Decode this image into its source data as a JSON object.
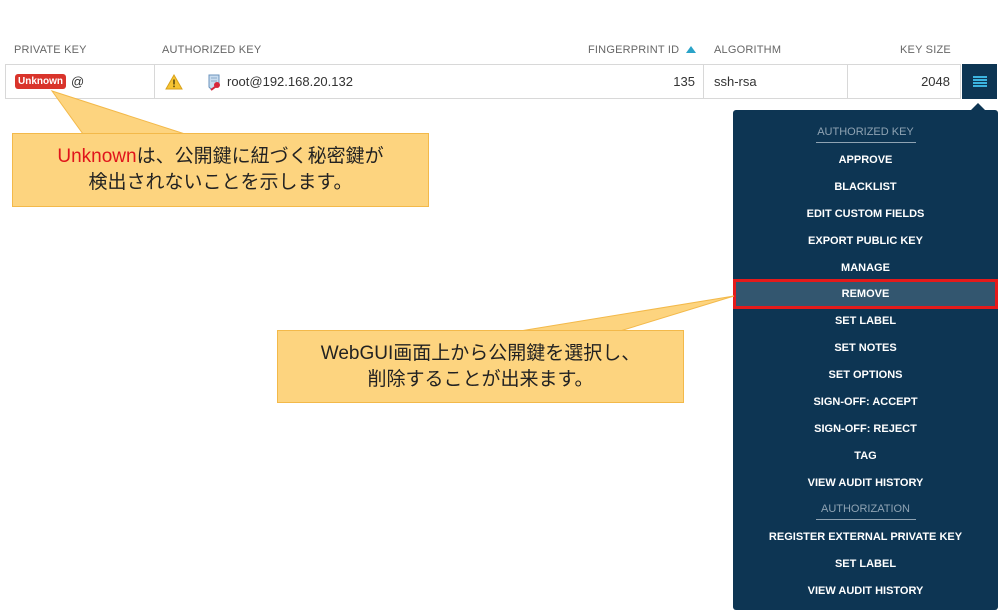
{
  "table": {
    "headers": {
      "private_key": "PRIVATE KEY",
      "authorized_key": "AUTHORIZED KEY",
      "fingerprint_id": "FINGERPRINT ID",
      "algorithm": "ALGORITHM",
      "key_size": "KEY SIZE"
    },
    "sort": {
      "column": "fingerprint_id",
      "direction": "ascending",
      "icon": "sort-up-triangle"
    },
    "rows": [
      {
        "private_key_badge": "Unknown",
        "private_key_text": "@",
        "warning_icon": "warning-triangle-icon",
        "key_icon": "public-key-icon",
        "authorized_key": "root@192.168.20.132",
        "fingerprint_id": "135",
        "algorithm": "ssh-rsa",
        "key_size": "2048"
      }
    ]
  },
  "actions_menu": {
    "button_icon": "hamburger-menu-icon",
    "sections": [
      {
        "title": "AUTHORIZED KEY",
        "items": [
          "APPROVE",
          "BLACKLIST",
          "EDIT CUSTOM FIELDS",
          "EXPORT PUBLIC KEY",
          "MANAGE",
          "REMOVE",
          "SET LABEL",
          "SET NOTES",
          "SET OPTIONS",
          "SIGN-OFF: ACCEPT",
          "SIGN-OFF: REJECT",
          "TAG",
          "VIEW AUDIT HISTORY"
        ]
      },
      {
        "title": "AUTHORIZATION",
        "items": [
          "REGISTER EXTERNAL PRIVATE KEY",
          "SET LABEL",
          "VIEW AUDIT HISTORY"
        ]
      }
    ],
    "highlighted_item": "REMOVE",
    "highlight_color": "#e51a1a"
  },
  "annotations": [
    {
      "highlight": "Unknown",
      "line1_rest": "は、公開鍵に紐づく秘密鍵が",
      "line2": "検出されないことを示します。"
    },
    {
      "line1": "WebGUI画面上から公開鍵を選択し、",
      "line2": "削除することが出来ます。"
    }
  ],
  "colors": {
    "menu_bg": "#0d3553",
    "badge_bg": "#d9342b",
    "callout_bg": "#fdd47f",
    "sort_accent": "#2aa3c8"
  }
}
